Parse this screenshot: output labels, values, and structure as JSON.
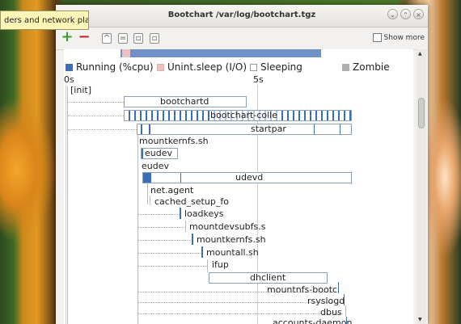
{
  "tooltip": "ders and network places",
  "window": {
    "title": "Bootchart /var/log/bootchart.tgz",
    "controls": [
      "⌄",
      "⌃",
      "×"
    ]
  },
  "toolbar": {
    "add_icon": "plus-icon",
    "remove_icon": "minus-icon",
    "show_more": "Show more"
  },
  "legend": {
    "running": "Running (%cpu)",
    "unint": "Unint.sleep (I/O)",
    "sleeping": "Sleeping",
    "zombie": "Zombie",
    "colors": {
      "running": "#3a6fb5",
      "unint": "#f0c0c0",
      "sleeping": "#ffffff",
      "zombie": "#b0b0b0"
    }
  },
  "axis": {
    "t0": "0s",
    "t5": "5s"
  },
  "processes": {
    "init": "[init]",
    "bootchartd": "bootchartd",
    "bootchart_colle": "bootchart-colle",
    "startpar": "startpar",
    "mountkernfs1": "mountkernfs.sh",
    "eudev1": "eudev",
    "eudev2": "eudev",
    "udevd": "udevd",
    "netagent": "net.agent",
    "cached_setup": "cached_setup_fo",
    "loadkeys": "loadkeys",
    "mountdevsubfs": "mountdevsubfs.s",
    "mountkernfs2": "mountkernfs.sh",
    "mountall": "mountall.sh",
    "ifup": "ifup",
    "dhclient": "dhclient",
    "mountnfs": "mountnfs-bootcl",
    "rsyslogd": "rsyslogd",
    "dbus": "dbus",
    "accounts": "accounts-daemon"
  }
}
